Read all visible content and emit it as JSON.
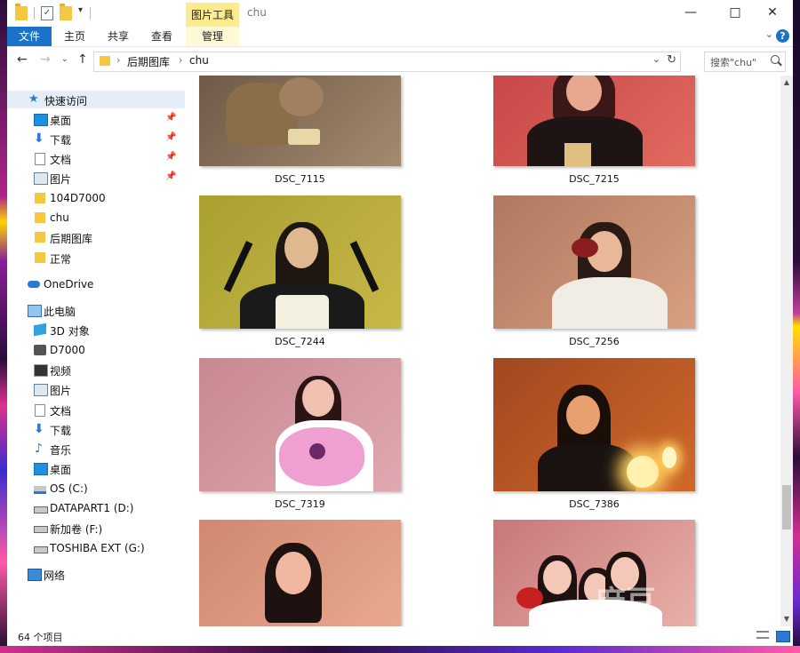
{
  "window": {
    "title": "chu"
  },
  "quick_access_toolbar": {
    "icons": [
      "folder-icon",
      "properties-icon",
      "new-folder-icon",
      "customize-arrow-icon"
    ]
  },
  "ribbon": {
    "context_tab": "图片工具",
    "tabs": [
      {
        "label": "文件",
        "active": true
      },
      {
        "label": "主页"
      },
      {
        "label": "共享"
      },
      {
        "label": "查看"
      },
      {
        "label": "管理"
      }
    ]
  },
  "address_bar": {
    "breadcrumbs": [
      "后期图库",
      "chu"
    ],
    "search_placeholder": "搜索\"chu\""
  },
  "sidebar": {
    "quick_access": "快速访问",
    "quick_items": [
      {
        "label": "桌面",
        "pinned": true,
        "icon": "desktop-icon"
      },
      {
        "label": "下载",
        "pinned": true,
        "icon": "download-icon"
      },
      {
        "label": "文档",
        "pinned": true,
        "icon": "document-icon"
      },
      {
        "label": "图片",
        "pinned": true,
        "icon": "picture-icon"
      },
      {
        "label": "104D7000",
        "icon": "folder-icon"
      },
      {
        "label": "chu",
        "icon": "folder-icon"
      },
      {
        "label": "后期图库",
        "icon": "folder-icon"
      },
      {
        "label": "正常",
        "icon": "folder-icon"
      }
    ],
    "onedrive": "OneDrive",
    "this_pc": "此电脑",
    "pc_items": [
      {
        "label": "3D 对象",
        "icon": "3d-objects-icon"
      },
      {
        "label": "D7000",
        "icon": "camera-icon"
      },
      {
        "label": "视频",
        "icon": "video-icon"
      },
      {
        "label": "图片",
        "icon": "picture-icon"
      },
      {
        "label": "文档",
        "icon": "document-icon"
      },
      {
        "label": "下载",
        "icon": "download-icon"
      },
      {
        "label": "音乐",
        "icon": "music-icon"
      },
      {
        "label": "桌面",
        "icon": "desktop-icon"
      },
      {
        "label": "OS (C:)",
        "icon": "os-drive-icon"
      },
      {
        "label": "DATAPART1 (D:)",
        "icon": "drive-icon"
      },
      {
        "label": "新加卷 (F:)",
        "icon": "drive-icon"
      },
      {
        "label": "TOSHIBA EXT (G:)",
        "icon": "drive-icon"
      }
    ],
    "network": "网络"
  },
  "files": [
    {
      "name": "DSC_7115",
      "colors": [
        "#6e5a48",
        "#a48a6e"
      ]
    },
    {
      "name": "DSC_7215",
      "colors": [
        "#c84848",
        "#e06a60"
      ]
    },
    {
      "name": "DSC_7244",
      "colors": [
        "#a8a030",
        "#c8b848"
      ]
    },
    {
      "name": "DSC_7256",
      "colors": [
        "#b07860",
        "#d8a080"
      ]
    },
    {
      "name": "DSC_7319",
      "colors": [
        "#c88890",
        "#e0a8b0"
      ]
    },
    {
      "name": "DSC_7386",
      "colors": [
        "#a04820",
        "#d06828"
      ]
    },
    {
      "name": "",
      "colors": [
        "#d08870",
        "#e8a890"
      ]
    },
    {
      "name": "",
      "colors": [
        "#c87878",
        "#e8b0a8"
      ]
    }
  ],
  "status": {
    "item_count": "64 个项目"
  },
  "watermark": "麻豆"
}
